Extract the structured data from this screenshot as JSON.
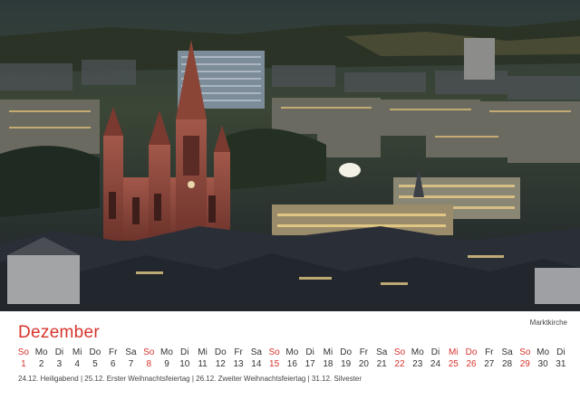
{
  "calendar": {
    "month": "Dezember",
    "caption": "Marktkirche",
    "holidays": "24.12. Heiligabend | 25.12. Erster Weihnachtsfeiertag | 26.12. Zweiter Weihnachtsfeiertag | 31.12. Silvester",
    "highlight_color": "#d6342c",
    "days": [
      {
        "wd": "So",
        "n": "1",
        "red": true
      },
      {
        "wd": "Mo",
        "n": "2",
        "red": false
      },
      {
        "wd": "Di",
        "n": "3",
        "red": false
      },
      {
        "wd": "Mi",
        "n": "4",
        "red": false
      },
      {
        "wd": "Do",
        "n": "5",
        "red": false
      },
      {
        "wd": "Fr",
        "n": "6",
        "red": false
      },
      {
        "wd": "Sa",
        "n": "7",
        "red": false
      },
      {
        "wd": "So",
        "n": "8",
        "red": true
      },
      {
        "wd": "Mo",
        "n": "9",
        "red": false
      },
      {
        "wd": "Di",
        "n": "10",
        "red": false
      },
      {
        "wd": "Mi",
        "n": "11",
        "red": false
      },
      {
        "wd": "Do",
        "n": "12",
        "red": false
      },
      {
        "wd": "Fr",
        "n": "13",
        "red": false
      },
      {
        "wd": "Sa",
        "n": "14",
        "red": false
      },
      {
        "wd": "So",
        "n": "15",
        "red": true
      },
      {
        "wd": "Mo",
        "n": "16",
        "red": false
      },
      {
        "wd": "Di",
        "n": "17",
        "red": false
      },
      {
        "wd": "Mi",
        "n": "18",
        "red": false
      },
      {
        "wd": "Do",
        "n": "19",
        "red": false
      },
      {
        "wd": "Fr",
        "n": "20",
        "red": false
      },
      {
        "wd": "Sa",
        "n": "21",
        "red": false
      },
      {
        "wd": "So",
        "n": "22",
        "red": true
      },
      {
        "wd": "Mo",
        "n": "23",
        "red": false
      },
      {
        "wd": "Di",
        "n": "24",
        "red": false
      },
      {
        "wd": "Mi",
        "n": "25",
        "red": true
      },
      {
        "wd": "Do",
        "n": "26",
        "red": true
      },
      {
        "wd": "Fr",
        "n": "27",
        "red": false
      },
      {
        "wd": "Sa",
        "n": "28",
        "red": false
      },
      {
        "wd": "So",
        "n": "29",
        "red": true
      },
      {
        "wd": "Mo",
        "n": "30",
        "red": false
      },
      {
        "wd": "Di",
        "n": "31",
        "red": false
      }
    ]
  }
}
